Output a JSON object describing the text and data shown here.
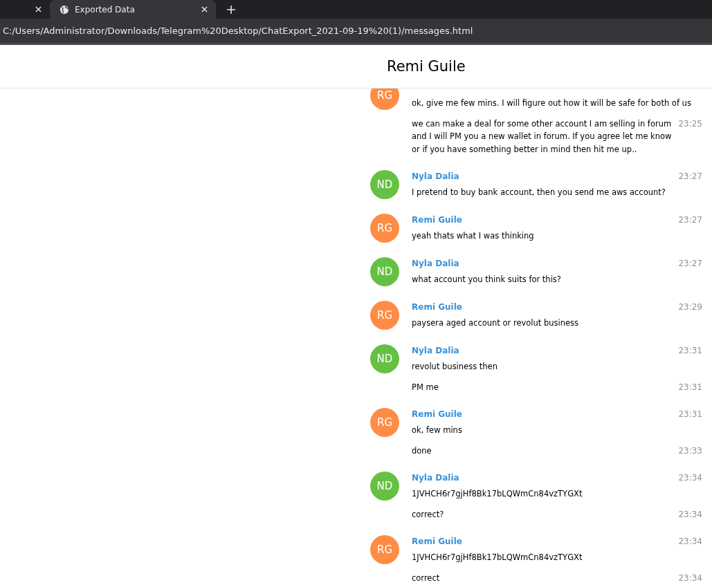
{
  "tabs": [
    {
      "selected": false
    },
    {
      "title": "Exported Data",
      "selected": true
    }
  ],
  "address_bar": {
    "url": "C:/Users/Administrator/Downloads/Telegram%20Desktop/ChatExport_2021-09-19%20(1)/messages.html"
  },
  "chat": {
    "title": "Remi Guile"
  },
  "groups": [
    {
      "initials": "RG",
      "color": "#ff8c44",
      "messages": [
        {
          "text": "ok, give me few mins. I will figure out how it will be safe for both of us"
        },
        {
          "text": "we can make a deal for some other account I am selling in forum and I will PM you a new wallet in forum. If you agree let me know or if you have something better in mind then hit me up..",
          "time": "23:25"
        }
      ]
    },
    {
      "initials": "ND",
      "color": "#65c144",
      "name": "Nyla Dalia",
      "time": "23:27",
      "messages": [
        {
          "text": "I pretend to buy bank account, then you send me aws account?"
        }
      ]
    },
    {
      "initials": "RG",
      "color": "#ff8c44",
      "name": "Remi Guile",
      "time": "23:27",
      "messages": [
        {
          "text": "yeah thats what I was thinking"
        }
      ]
    },
    {
      "initials": "ND",
      "color": "#65c144",
      "name": "Nyla Dalia",
      "time": "23:27",
      "messages": [
        {
          "text": "what account you think suits for this?"
        }
      ]
    },
    {
      "initials": "RG",
      "color": "#ff8c44",
      "name": "Remi Guile",
      "time": "23:29",
      "messages": [
        {
          "text": "paysera aged account or revolut business"
        }
      ]
    },
    {
      "initials": "ND",
      "color": "#65c144",
      "name": "Nyla Dalia",
      "time": "23:31",
      "messages": [
        {
          "text": "revolut business then"
        },
        {
          "text": "PM me",
          "time": "23:31"
        }
      ]
    },
    {
      "initials": "RG",
      "color": "#ff8c44",
      "name": "Remi Guile",
      "time": "23:31",
      "messages": [
        {
          "text": "ok, few mins"
        },
        {
          "text": "done",
          "time": "23:33"
        }
      ]
    },
    {
      "initials": "ND",
      "color": "#65c144",
      "name": "Nyla Dalia",
      "time": "23:34",
      "messages": [
        {
          "text": "1JVHCH6r7gjHf8Bk17bLQWmCn84vzTYGXt"
        },
        {
          "text": "correct?",
          "time": "23:34"
        }
      ]
    },
    {
      "initials": "RG",
      "color": "#ff8c44",
      "name": "Remi Guile",
      "time": "23:34",
      "messages": [
        {
          "text": "1JVHCH6r7gjHf8Bk17bLQWmCn84vzTYGXt"
        },
        {
          "text": "correct",
          "time": "23:34"
        }
      ]
    }
  ]
}
